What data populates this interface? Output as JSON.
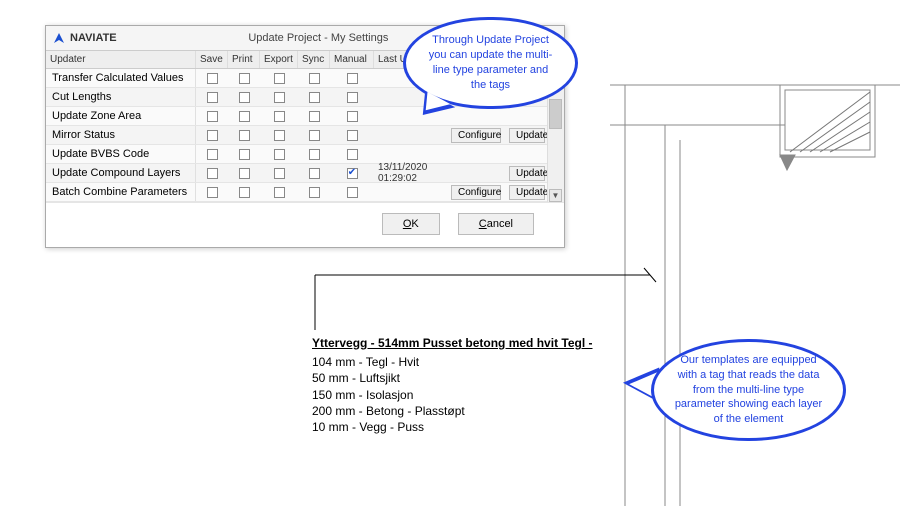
{
  "brand": "NAVIATE",
  "dialog": {
    "title": "Update Project - My Settings",
    "columns": [
      "Updater",
      "Save",
      "Print",
      "Export",
      "Sync",
      "Manual",
      "Last Update",
      "",
      ""
    ],
    "rows": [
      {
        "name": "Transfer Calculated Values",
        "save": false,
        "print": false,
        "export": false,
        "sync": false,
        "manual": false,
        "lastUpdate": "",
        "configure": "",
        "update": ""
      },
      {
        "name": "Cut Lengths",
        "save": false,
        "print": false,
        "export": false,
        "sync": false,
        "manual": false,
        "lastUpdate": "",
        "configure": "",
        "update": ""
      },
      {
        "name": "Update Zone Area",
        "save": false,
        "print": false,
        "export": false,
        "sync": false,
        "manual": false,
        "lastUpdate": "",
        "configure": "",
        "update": ""
      },
      {
        "name": "Mirror Status",
        "save": false,
        "print": false,
        "export": false,
        "sync": false,
        "manual": false,
        "lastUpdate": "",
        "configure": "Configure",
        "update": "Update"
      },
      {
        "name": "Update BVBS Code",
        "save": false,
        "print": false,
        "export": false,
        "sync": false,
        "manual": false,
        "lastUpdate": "",
        "configure": "",
        "update": ""
      },
      {
        "name": "Update Compound Layers",
        "save": false,
        "print": false,
        "export": false,
        "sync": false,
        "manual": true,
        "lastUpdate": "13/11/2020 01:29:02",
        "configure": "",
        "update": "Update"
      },
      {
        "name": "Batch Combine Parameters",
        "save": false,
        "print": false,
        "export": false,
        "sync": false,
        "manual": false,
        "lastUpdate": "",
        "configure": "Configure",
        "update": "Update"
      }
    ],
    "buttons": {
      "ok_full": "OK",
      "ok_u": "O",
      "ok_rest": "K",
      "cancel_u": "C",
      "cancel_rest": "ancel"
    }
  },
  "callouts": {
    "top": "Through Update Project you can update the multi-line type parameter and the tags",
    "right": "Our templates are equipped with a tag that reads the data from the multi-line type parameter showing each layer of the element"
  },
  "tag": {
    "title": "Yttervegg - 514mm Pusset betong med hvit Tegl -",
    "layers": [
      "104 mm - Tegl - Hvit",
      "50 mm - Luftsjikt",
      "150 mm - Isolasjon",
      "200 mm - Betong - Plasstøpt",
      "10 mm - Vegg - Puss"
    ]
  }
}
